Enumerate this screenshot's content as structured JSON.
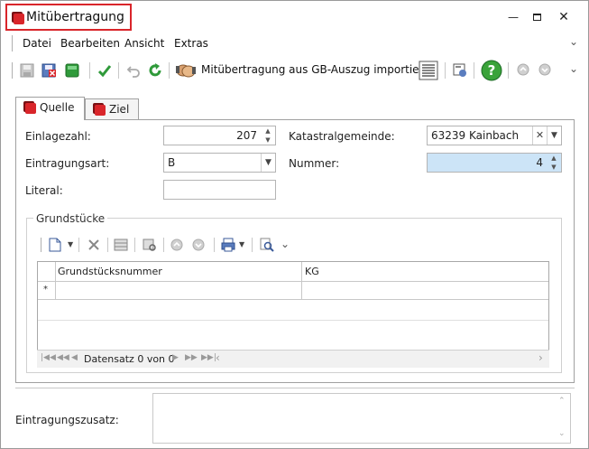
{
  "window": {
    "title": "Mitübertragung"
  },
  "menu": {
    "items": [
      "Datei",
      "Bearbeiten",
      "Ansicht",
      "Extras"
    ]
  },
  "toolbar": {
    "import_label": "Mitübertragung aus GB-Auszug importieren"
  },
  "tabs": [
    {
      "label": "Quelle",
      "active": true
    },
    {
      "label": "Ziel",
      "active": false
    }
  ],
  "form": {
    "einlagezahl_label": "Einlagezahl:",
    "einlagezahl_value": "207",
    "katastralgemeinde_label": "Katastralgemeinde:",
    "katastralgemeinde_value": "63239 Kainbach",
    "eintragungsart_label": "Eintragungsart:",
    "eintragungsart_value": "B",
    "nummer_label": "Nummer:",
    "nummer_value": "4",
    "literal_label": "Literal:",
    "literal_value": ""
  },
  "grundstuecke": {
    "group_label": "Grundstücke",
    "columns": [
      "Grundstücksnummer",
      "KG"
    ],
    "new_row_marker": "*",
    "rows": [],
    "nav_text": "Datensatz 0 von 0"
  },
  "eintragungszusatz": {
    "label": "Eintragungszusatz:",
    "value": ""
  },
  "colors": {
    "accent_red": "#d9252a",
    "highlight_input": "#cce4f7",
    "help_green": "#3aa33a"
  }
}
